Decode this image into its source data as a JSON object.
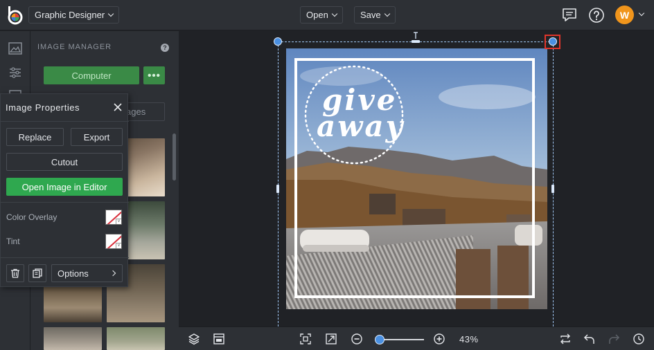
{
  "topbar": {
    "mode_label": "Graphic Designer",
    "open_label": "Open",
    "save_label": "Save",
    "avatar_initial": "W",
    "avatar_color": "#f0951c"
  },
  "image_manager": {
    "title": "IMAGE MANAGER",
    "help_glyph": "?",
    "computer_label": "Computer",
    "more_label": "•••",
    "tab_images_label": "ages"
  },
  "image_properties": {
    "title": "Image Properties",
    "replace_label": "Replace",
    "export_label": "Export",
    "cutout_label": "Cutout",
    "open_editor_label": "Open Image in Editor",
    "color_overlay_label": "Color Overlay",
    "tint_label": "Tint",
    "options_label": "Options"
  },
  "canvas": {
    "giveaway_line1": "give",
    "giveaway_line2": "away"
  },
  "bottombar": {
    "zoom_level": "43%",
    "zoom_fraction": 0.05
  },
  "colors": {
    "accent_green": "#2fa84f",
    "accent_blue": "#4a90e2",
    "selection_red": "#e1352b"
  }
}
